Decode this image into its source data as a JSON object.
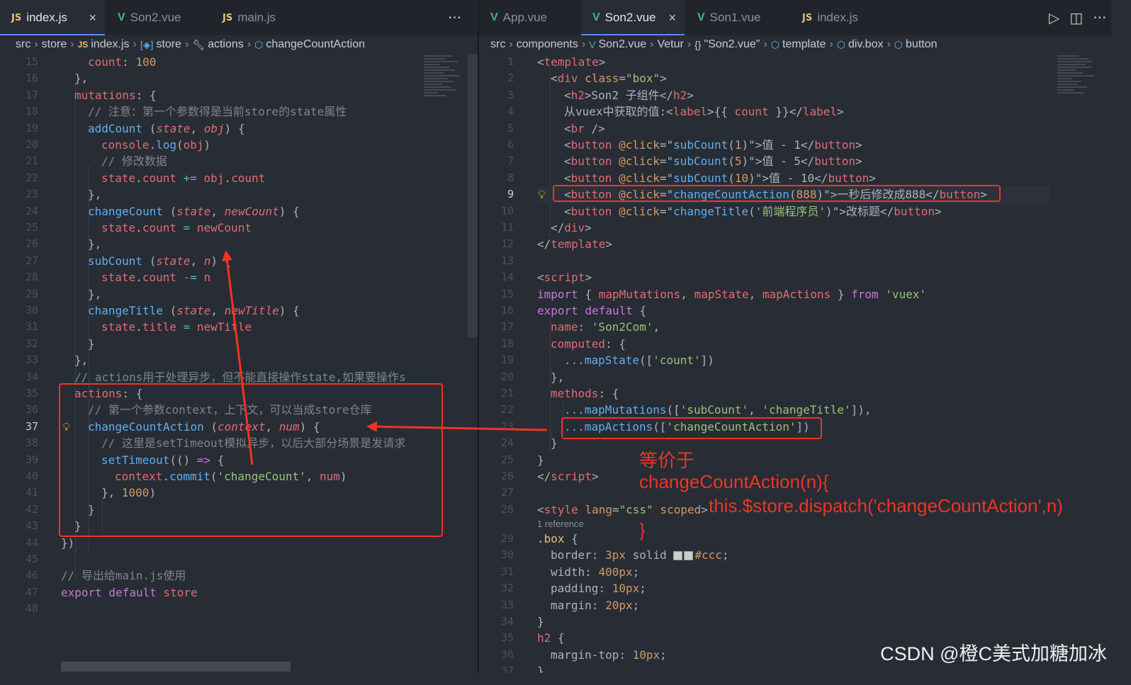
{
  "left": {
    "tabs": [
      {
        "icon": "JS",
        "label": "index.js",
        "close": "×"
      },
      {
        "icon": "V",
        "label": "Son2.vue"
      },
      {
        "icon": "JS",
        "label": "main.js"
      }
    ],
    "more": "···",
    "breadcrumb": {
      "c0": "src",
      "c1": "store",
      "c2": "index.js",
      "c3": "store",
      "c4": "actions",
      "c5": "changeCountAction"
    },
    "lines": [
      {
        "n": "15"
      },
      {
        "n": "16"
      },
      {
        "n": "17"
      },
      {
        "n": "18"
      },
      {
        "n": "19"
      },
      {
        "n": "20"
      },
      {
        "n": "21"
      },
      {
        "n": "22"
      },
      {
        "n": "23"
      },
      {
        "n": "24"
      },
      {
        "n": "25"
      },
      {
        "n": "26"
      },
      {
        "n": "27"
      },
      {
        "n": "28"
      },
      {
        "n": "29"
      },
      {
        "n": "30"
      },
      {
        "n": "31"
      },
      {
        "n": "32"
      },
      {
        "n": "33"
      },
      {
        "n": "34"
      },
      {
        "n": "35"
      },
      {
        "n": "36"
      },
      {
        "n": "37"
      },
      {
        "n": "38"
      },
      {
        "n": "39"
      },
      {
        "n": "40"
      },
      {
        "n": "41"
      },
      {
        "n": "42"
      },
      {
        "n": "43"
      },
      {
        "n": "44"
      },
      {
        "n": "45"
      },
      {
        "n": "46"
      },
      {
        "n": "47"
      },
      {
        "n": "48"
      }
    ],
    "code": {
      "l15a": "count",
      "l15b": ": ",
      "l15c": "100",
      "l16": "},",
      "l17a": "mutations",
      "l17b": ": {",
      "l18": "// 注意：第一个参数得是当前store的state属性",
      "l19a": "addCount",
      "l19b": " (",
      "l19c": "state",
      "l19d": ", ",
      "l19e": "obj",
      "l19f": ") {",
      "l20a": "console",
      "l20b": ".",
      "l20c": "log",
      "l20d": "(",
      "l20e": "obj",
      "l20f": ")",
      "l21": "// 修改数据",
      "l22a": "state",
      "l22b": ".",
      "l22c": "count",
      "l22d": " += ",
      "l22e": "obj",
      "l22f": ".",
      "l22g": "count",
      "l23": "},",
      "l24a": "changeCount",
      "l24b": " (",
      "l24c": "state",
      "l24d": ", ",
      "l24e": "newCount",
      "l24f": ") {",
      "l25a": "state",
      "l25b": ".",
      "l25c": "count",
      "l25d": " = ",
      "l25e": "newCount",
      "l26": "},",
      "l27a": "subCount",
      "l27b": " (",
      "l27c": "state",
      "l27d": ", ",
      "l27e": "n",
      "l27f": ") {",
      "l28a": "state",
      "l28b": ".",
      "l28c": "count",
      "l28d": " -= ",
      "l28e": "n",
      "l29": "},",
      "l30a": "changeTitle",
      "l30b": " (",
      "l30c": "state",
      "l30d": ", ",
      "l30e": "newTitle",
      "l30f": ") {",
      "l31a": "state",
      "l31b": ".",
      "l31c": "title",
      "l31d": " = ",
      "l31e": "newTitle",
      "l32": "}",
      "l33": "},",
      "l34": "// actions用于处理异步，但不能直接操作state,如果要操作s",
      "l35a": "actions",
      "l35b": ": {",
      "l36": "// 第一个参数context，上下文，可以当成store仓库",
      "l37a": "changeCountAction",
      "l37b": " (",
      "l37c": "context",
      "l37d": ", ",
      "l37e": "num",
      "l37f": ") {",
      "l38": "// 这里是setTimeout模拟异步，以后大部分场景是发请求",
      "l39a": "setTimeout",
      "l39b": "(() ",
      "l39c": "=>",
      "l39d": " {",
      "l40a": "context",
      "l40b": ".",
      "l40c": "commit",
      "l40d": "(",
      "l40e": "'changeCount'",
      "l40f": ", ",
      "l40g": "num",
      "l40h": ")",
      "l41a": "}, ",
      "l41b": "1000",
      "l41c": ")",
      "l42": "}",
      "l43": "}",
      "l44": "})",
      "l46": "// 导出给main.js使用",
      "l47a": "export",
      "l47b": " default ",
      "l47c": "store"
    }
  },
  "right": {
    "tabs": [
      {
        "icon": "V",
        "label": "App.vue"
      },
      {
        "icon": "V",
        "label": "Son2.vue",
        "close": "×"
      },
      {
        "icon": "V",
        "label": "Son1.vue"
      },
      {
        "icon": "JS",
        "label": "index.js"
      }
    ],
    "actions": {
      "run": "▷",
      "split": "◫",
      "more": "···"
    },
    "breadcrumb": {
      "c0": "src",
      "c1": "components",
      "c2": "Son2.vue",
      "c3": "Vetur",
      "c4": "\"Son2.vue\"",
      "c5": "template",
      "c6": "div.box",
      "c7": "button",
      "braces": "{}"
    },
    "lines": [
      {
        "n": "1"
      },
      {
        "n": "2"
      },
      {
        "n": "3"
      },
      {
        "n": "4"
      },
      {
        "n": "5"
      },
      {
        "n": "6"
      },
      {
        "n": "7"
      },
      {
        "n": "8"
      },
      {
        "n": "9"
      },
      {
        "n": "10"
      },
      {
        "n": "11"
      },
      {
        "n": "12"
      },
      {
        "n": "13"
      },
      {
        "n": "14"
      },
      {
        "n": "15"
      },
      {
        "n": "16"
      },
      {
        "n": "17"
      },
      {
        "n": "18"
      },
      {
        "n": "19"
      },
      {
        "n": "20"
      },
      {
        "n": "21"
      },
      {
        "n": "22"
      },
      {
        "n": "23"
      },
      {
        "n": "24"
      },
      {
        "n": "25"
      },
      {
        "n": "26"
      },
      {
        "n": "27"
      },
      {
        "n": "28"
      },
      {
        "n": "29"
      },
      {
        "n": "30"
      },
      {
        "n": "31"
      },
      {
        "n": "32"
      },
      {
        "n": "33"
      },
      {
        "n": "34"
      },
      {
        "n": "35"
      },
      {
        "n": "36"
      },
      {
        "n": "37"
      }
    ],
    "reference": "1 reference",
    "code": {
      "r1a": "<",
      "r1b": "template",
      "r1c": ">",
      "r2a": "<",
      "r2b": "div",
      "r2c": " class",
      "r2d": "=",
      "r2e": "\"box\"",
      "r2f": ">",
      "r3a": "<",
      "r3b": "h2",
      "r3c": ">Son2 子组件</",
      "r3d": "h2",
      "r3e": ">",
      "r4a": "从vuex中获取的值:<",
      "r4b": "label",
      "r4c": ">{{ ",
      "r4d": "count",
      "r4e": " }}</",
      "r4f": "label",
      "r4g": ">",
      "r5a": "<",
      "r5b": "br",
      "r5c": " />",
      "r6a": "<",
      "r6b": "button",
      "r6c": " @click",
      "r6d": "=\"",
      "r6e": "subCount",
      "r6f": "(",
      "r6g": "1",
      "r6h": ")\">值 - 1</",
      "r6i": "button",
      "r6j": ">",
      "r7a": "<",
      "r7b": "button",
      "r7c": " @click",
      "r7d": "=\"",
      "r7e": "subCount",
      "r7f": "(",
      "r7g": "5",
      "r7h": ")\">值 - 5</",
      "r7i": "button",
      "r7j": ">",
      "r8a": "<",
      "r8b": "button",
      "r8c": " @click",
      "r8d": "=\"",
      "r8e": "subCount",
      "r8f": "(",
      "r8g": "10",
      "r8h": ")\">值 - 10</",
      "r8i": "button",
      "r8j": ">",
      "r9a": "<",
      "r9b": "button",
      "r9c": " @click",
      "r9d": "=\"",
      "r9e": "changeCountAction",
      "r9f": "(",
      "r9g": "888",
      "r9h": ")\">一秒后修改成888</",
      "r9i": "button",
      "r9j": ">",
      "r10a": "<",
      "r10b": "button",
      "r10c": " @click",
      "r10d": "=\"",
      "r10e": "changeTitle",
      "r10f": "(",
      "r10g": "'前端程序员'",
      "r10h": ")\">改标题</",
      "r10i": "button",
      "r10j": ">",
      "r11a": "</",
      "r11b": "div",
      "r11c": ">",
      "r12a": "</",
      "r12b": "template",
      "r12c": ">",
      "r14a": "<",
      "r14b": "script",
      "r14c": ">",
      "r15a": "import",
      "r15b": " { ",
      "r15c": "mapMutations",
      "r15d": ", ",
      "r15e": "mapState",
      "r15f": ", ",
      "r15g": "mapActions",
      "r15h": " } ",
      "r15i": "from",
      "r15j": " ",
      "r15k": "'vuex'",
      "r16a": "export",
      "r16b": " ",
      "r16c": "default",
      "r16d": " {",
      "r17a": "name",
      "r17b": ": ",
      "r17c": "'Son2Com'",
      "r17d": ",",
      "r18a": "computed",
      "r18b": ": {",
      "r19a": "...",
      "r19b": "mapState",
      "r19c": "([",
      "r19d": "'count'",
      "r19e": "])",
      "r20": "},",
      "r21a": "methods",
      "r21b": ": {",
      "r22a": "...",
      "r22b": "mapMutations",
      "r22c": "([",
      "r22d": "'subCount'",
      "r22e": ", ",
      "r22f": "'changeTitle'",
      "r22g": "]),",
      "r23a": "...",
      "r23b": "mapActions",
      "r23c": "([",
      "r23d": "'changeCountAction'",
      "r23e": "])",
      "r24": "}",
      "r25": "}",
      "r26a": "</",
      "r26b": "script",
      "r26c": ">",
      "r28a": "<",
      "r28b": "style",
      "r28c": " lang",
      "r28d": "=",
      "r28e": "\"css\"",
      "r28f": " scoped",
      "r28g": ">",
      "r29a": ".box",
      "r29b": " {",
      "r30a": "border",
      "r30b": ": ",
      "r30c": "3px",
      "r30d": " solid ",
      "r30e": "#ccc",
      "r30f": ";",
      "r31a": "width",
      "r31b": ": ",
      "r31c": "400px",
      "r31d": ";",
      "r32a": "padding",
      "r32b": ": ",
      "r32c": "10px",
      "r32d": ";",
      "r33a": "margin",
      "r33b": ": ",
      "r33c": "20px",
      "r33d": ";",
      "r34": "}",
      "r35a": "h2",
      "r35b": " {",
      "r36a": "margin-top",
      "r36b": ": ",
      "r36c": "10px",
      "r36d": ";",
      "r37": "}"
    }
  },
  "annotation": {
    "line1": "等价于",
    "line2": "changeCountAction(n){",
    "line3": "this.$store.dispatch('changeCountAction',n)",
    "line4": "}"
  },
  "watermark": "CSDN @橙C美式加糖加冰",
  "colors": {
    "annotation": "#ee3424",
    "active_tab_accent": "#528bff",
    "editor_bg": "#282c34"
  }
}
